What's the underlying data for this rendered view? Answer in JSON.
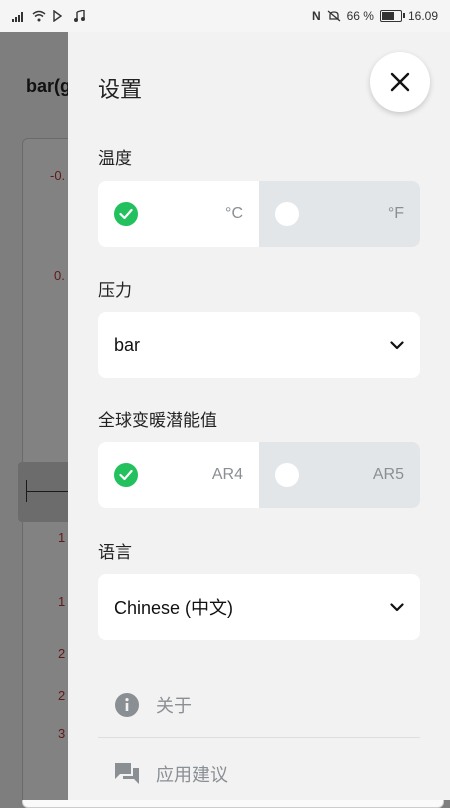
{
  "status_bar": {
    "battery": "66 %",
    "time": "16.09"
  },
  "background": {
    "title": "bar(g",
    "values": [
      "-0.",
      "0.",
      "1",
      "1",
      "2",
      "2",
      "3"
    ]
  },
  "settings": {
    "title": "设置",
    "temperature": {
      "label": "温度",
      "options": [
        "°C",
        "°F"
      ],
      "selected": 0
    },
    "pressure": {
      "label": "压力",
      "value": "bar"
    },
    "gwp": {
      "label": "全球变暖潜能值",
      "options": [
        "AR4",
        "AR5"
      ],
      "selected": 0
    },
    "language": {
      "label": "语言",
      "value": "Chinese (中文)"
    },
    "menu": {
      "about": "关于",
      "feedback": "应用建议"
    }
  },
  "colors": {
    "accent_green": "#22c15e",
    "inactive_gray": "#8a8f94"
  }
}
